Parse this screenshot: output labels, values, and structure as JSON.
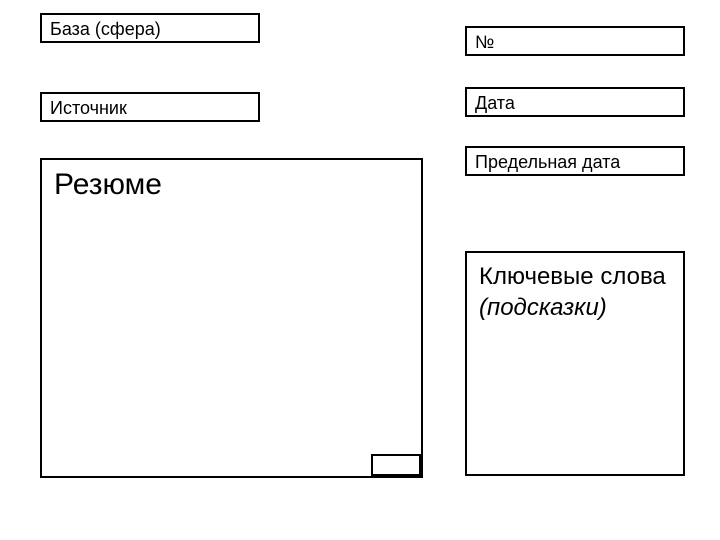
{
  "base": {
    "label": "База (сфера)"
  },
  "source": {
    "label": "Источник"
  },
  "number": {
    "label": "№"
  },
  "date": {
    "label": "Дата"
  },
  "deadline": {
    "label": "Предельная дата"
  },
  "summary": {
    "label": "Резюме"
  },
  "keywords": {
    "label_main": "Ключевые слова",
    "label_hint": "(подсказки)"
  }
}
